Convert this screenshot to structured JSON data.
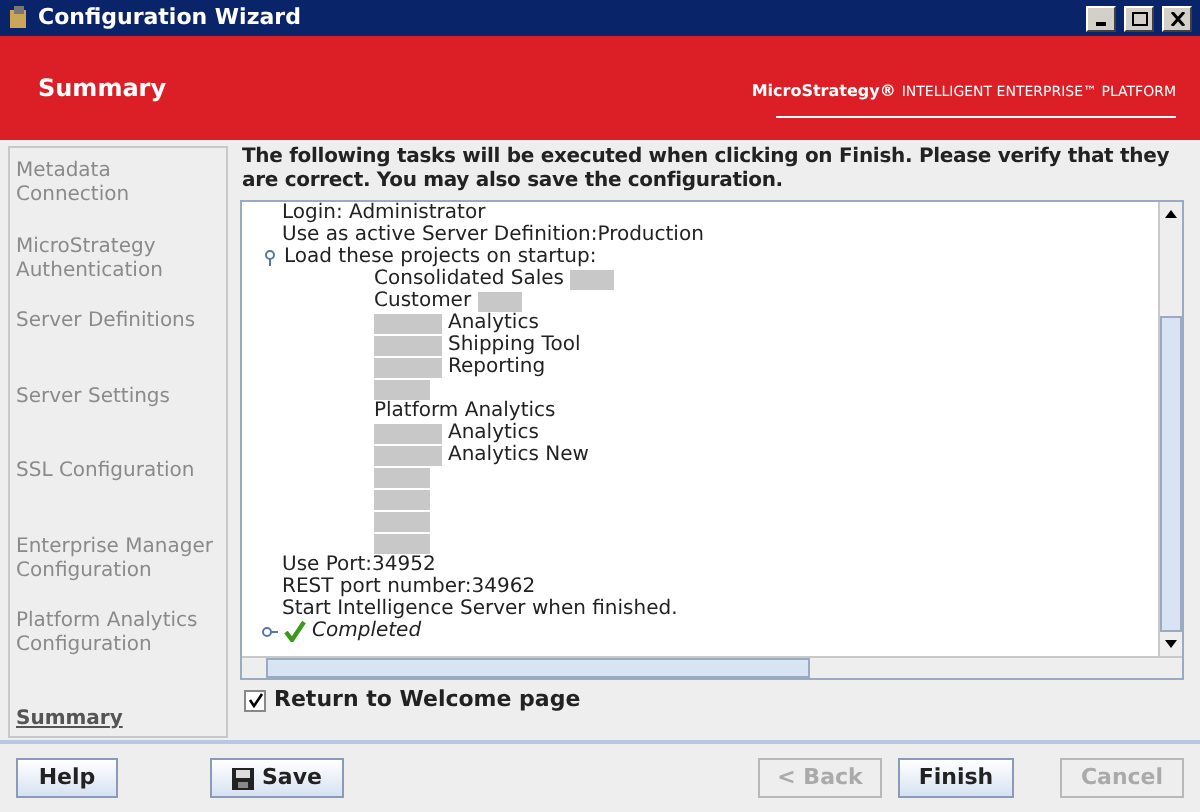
{
  "window": {
    "title": "Configuration Wizard"
  },
  "header": {
    "title": "Summary",
    "brand": "MicroStrategy®",
    "tagline": "INTELLIGENT ENTERPRISE™ PLATFORM"
  },
  "sidebar": {
    "items": [
      {
        "label": "Metadata Connection",
        "selected": false
      },
      {
        "label": "MicroStrategy Authentication",
        "selected": false
      },
      {
        "label": "Server Definitions",
        "selected": false
      },
      {
        "label": "Server Settings",
        "selected": false
      },
      {
        "label": "SSL Configuration",
        "selected": false
      },
      {
        "label": "Enterprise Manager Configuration",
        "selected": false
      },
      {
        "label": "Platform Analytics Configuration",
        "selected": false
      },
      {
        "label": "Summary",
        "selected": true
      }
    ]
  },
  "intro": "The following tasks will be executed when clicking on Finish. Please verify that they are correct. You may also save the configuration.",
  "tree": [
    {
      "text": "Login: Administrator",
      "kind": "text"
    },
    {
      "text": "Use as active Server Definition:Production",
      "kind": "text"
    },
    {
      "text": "Load these projects on startup:",
      "kind": "text",
      "expanded": true,
      "children": [
        {
          "text": "Consolidated Sales",
          "kind": "redacted-after"
        },
        {
          "text": "Customer",
          "kind": "redacted-after"
        },
        {
          "text": "Analytics",
          "kind": "redacted-before"
        },
        {
          "text": "Shipping Tool",
          "kind": "redacted-before"
        },
        {
          "text": "Reporting",
          "kind": "redacted-before"
        },
        {
          "kind": "redacted"
        },
        {
          "text": "Platform Analytics",
          "kind": "text"
        },
        {
          "text": "Analytics",
          "kind": "redacted-before"
        },
        {
          "text": "Analytics New",
          "kind": "redacted-before"
        },
        {
          "kind": "redacted"
        },
        {
          "kind": "redacted"
        },
        {
          "kind": "redacted"
        },
        {
          "kind": "redacted"
        }
      ]
    },
    {
      "text": "Use Port:34952",
      "kind": "text"
    },
    {
      "text": "REST port number:34962",
      "kind": "text"
    },
    {
      "text": "Start Intelligence Server when finished.",
      "kind": "text"
    },
    {
      "text": "Completed",
      "kind": "status",
      "expanded": false
    }
  ],
  "return_checkbox": {
    "label": "Return to Welcome page",
    "checked": true
  },
  "buttons": [
    {
      "label": "Help",
      "disabled": false,
      "kind": "plain"
    },
    {
      "label": "Save",
      "disabled": false,
      "kind": "save"
    },
    {
      "label": "< Back",
      "disabled": true,
      "kind": "plain"
    },
    {
      "label": "Finish",
      "disabled": false,
      "kind": "plain"
    },
    {
      "label": "Cancel",
      "disabled": true,
      "kind": "plain"
    }
  ]
}
